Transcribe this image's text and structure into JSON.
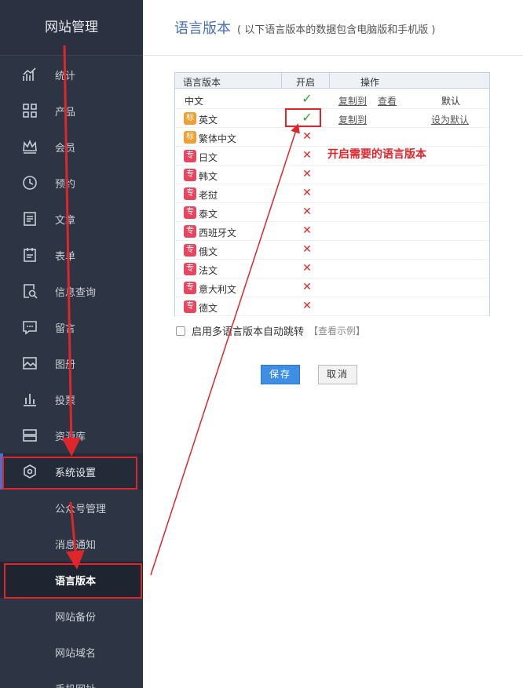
{
  "sidebar": {
    "brand": "网站管理",
    "items": [
      {
        "label": "统计",
        "icon": "stats-icon"
      },
      {
        "label": "产品",
        "icon": "grid-icon"
      },
      {
        "label": "会员",
        "icon": "crown-icon"
      },
      {
        "label": "预约",
        "icon": "clock-icon"
      },
      {
        "label": "文章",
        "icon": "article-icon"
      },
      {
        "label": "表单",
        "icon": "form-icon"
      },
      {
        "label": "信息查询",
        "icon": "search-doc-icon"
      },
      {
        "label": "留言",
        "icon": "message-icon"
      },
      {
        "label": "图册",
        "icon": "image-icon"
      },
      {
        "label": "投票",
        "icon": "bar-chart-icon"
      },
      {
        "label": "资源库",
        "icon": "storage-icon"
      },
      {
        "label": "系统设置",
        "icon": "settings-icon"
      }
    ],
    "subitems": [
      {
        "label": "公众号管理"
      },
      {
        "label": "消息通知"
      },
      {
        "label": "语言版本"
      },
      {
        "label": "网站备份"
      },
      {
        "label": "网站域名"
      },
      {
        "label": "手机网址"
      }
    ]
  },
  "header": {
    "title": "语言版本",
    "subtitle": "( 以下语言版本的数据包含电脑版和手机版 )"
  },
  "table": {
    "headers": [
      "语言版本",
      "开启",
      "操作"
    ],
    "rows": [
      {
        "name": "中文",
        "badge": "",
        "enabled": true,
        "copy": "复制到",
        "view": "查看",
        "default": "默认"
      },
      {
        "name": "英文",
        "badge": "标",
        "enabled": true,
        "copy": "复制到",
        "view": "",
        "default": "设为默认"
      },
      {
        "name": "繁体中文",
        "badge": "标",
        "enabled": false
      },
      {
        "name": "日文",
        "badge": "专",
        "enabled": false
      },
      {
        "name": "韩文",
        "badge": "专",
        "enabled": false
      },
      {
        "name": "老挝",
        "badge": "专",
        "enabled": false
      },
      {
        "name": "泰文",
        "badge": "专",
        "enabled": false
      },
      {
        "name": "西班牙文",
        "badge": "专",
        "enabled": false
      },
      {
        "name": "俄文",
        "badge": "专",
        "enabled": false
      },
      {
        "name": "法文",
        "badge": "专",
        "enabled": false
      },
      {
        "name": "意大利文",
        "badge": "专",
        "enabled": false
      },
      {
        "name": "德文",
        "badge": "专",
        "enabled": false
      }
    ]
  },
  "annotation": "开启需要的语言版本",
  "auto_jump": {
    "label": "启用多语言版本自动跳转",
    "example": "【查看示例】"
  },
  "buttons": {
    "save": "保存",
    "cancel": "取消"
  },
  "symbols": {
    "on": "✓",
    "off": "✕"
  },
  "colors": {
    "sidebar_bg": "#2d3444",
    "accent": "#4a6fd1",
    "annotation_red": "#e0262b",
    "check_green": "#2da82d",
    "save_blue": "#3f8ee6"
  }
}
